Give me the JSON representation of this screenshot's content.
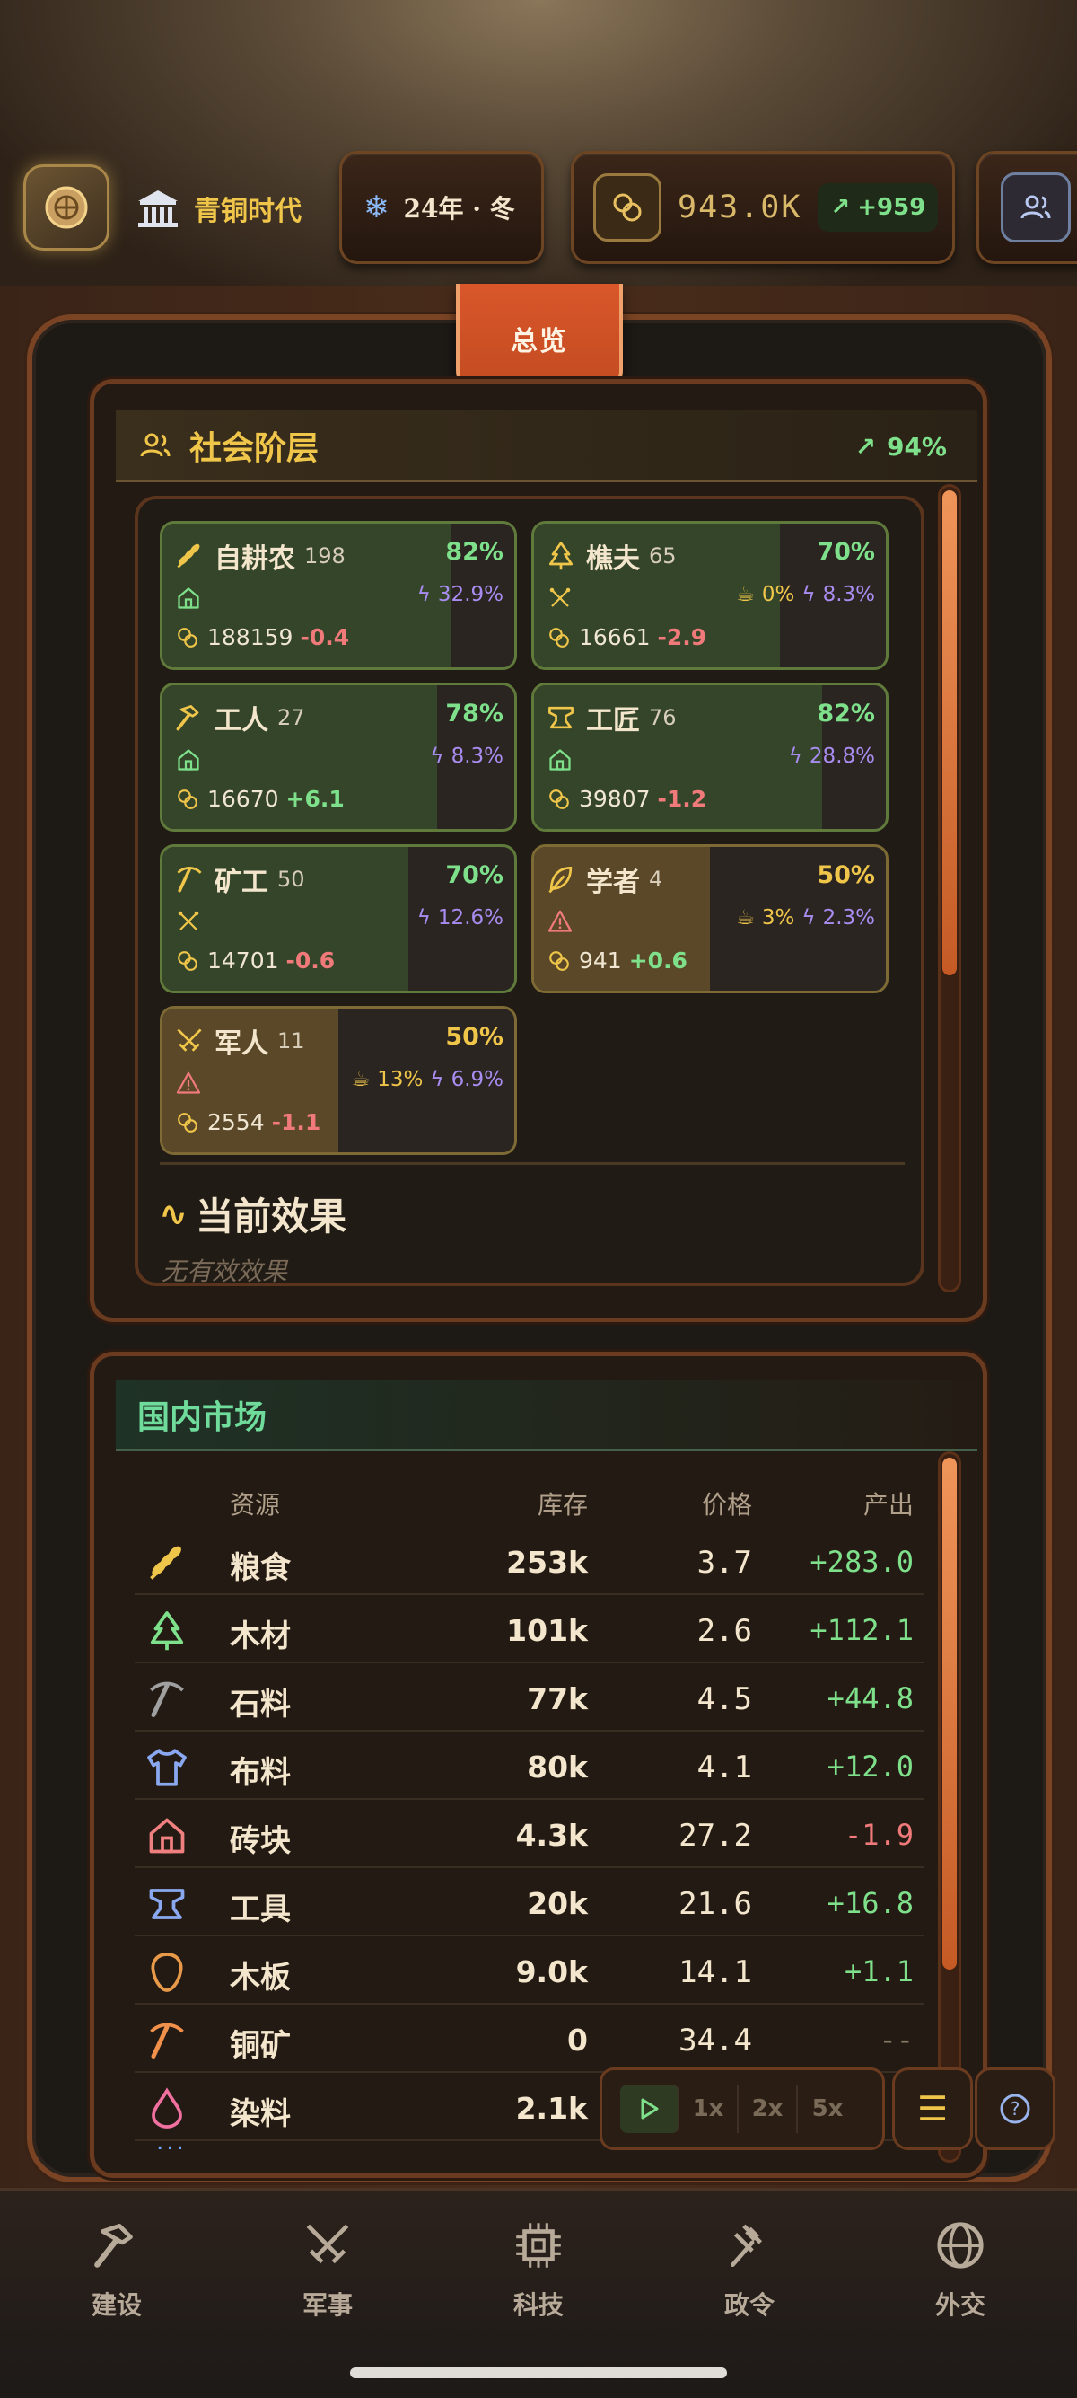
{
  "header": {
    "era": "青铜时代",
    "season": "24年 · 冬",
    "coins": "943.0K",
    "coin_delta": "+959"
  },
  "tab_overview": "总览",
  "social": {
    "title": "社会阶层",
    "approval": "94%",
    "cards": [
      {
        "name": "自耕农",
        "count": "198",
        "pct": "82%",
        "pct_color": "#7ee08a",
        "fill": 0.82,
        "tone": "green",
        "status_icon": "house-icon",
        "food": "",
        "energy": "32.9%",
        "money": "188159",
        "delta": "-0.4",
        "delta_sign": "neg",
        "icon": "wheat-icon"
      },
      {
        "name": "樵夫",
        "count": "65",
        "pct": "70%",
        "pct_color": "#7ee08a",
        "fill": 0.7,
        "tone": "green",
        "status_icon": "tools-icon",
        "food": "0%",
        "energy": "8.3%",
        "money": "16661",
        "delta": "-2.9",
        "delta_sign": "neg",
        "icon": "tree-icon"
      },
      {
        "name": "工人",
        "count": "27",
        "pct": "78%",
        "pct_color": "#7ee08a",
        "fill": 0.78,
        "tone": "green",
        "status_icon": "house-icon",
        "food": "",
        "energy": "8.3%",
        "money": "16670",
        "delta": "+6.1",
        "delta_sign": "pos",
        "icon": "hammer-icon"
      },
      {
        "name": "工匠",
        "count": "76",
        "pct": "82%",
        "pct_color": "#7ee08a",
        "fill": 0.82,
        "tone": "green",
        "status_icon": "house-icon",
        "food": "",
        "energy": "28.8%",
        "money": "39807",
        "delta": "-1.2",
        "delta_sign": "neg",
        "icon": "anvil-icon"
      },
      {
        "name": "矿工",
        "count": "50",
        "pct": "70%",
        "pct_color": "#7ee08a",
        "fill": 0.7,
        "tone": "green",
        "status_icon": "tools-icon",
        "food": "",
        "energy": "12.6%",
        "money": "14701",
        "delta": "-0.6",
        "delta_sign": "neg",
        "icon": "pickaxe-icon"
      },
      {
        "name": "学者",
        "count": "4",
        "pct": "50%",
        "pct_color": "#f0c64a",
        "fill": 0.5,
        "tone": "amber",
        "status_icon": "warning-icon",
        "food": "3%",
        "energy": "2.3%",
        "money": "941",
        "delta": "+0.6",
        "delta_sign": "pos",
        "icon": "feather-icon"
      },
      {
        "name": "军人",
        "count": "11",
        "pct": "50%",
        "pct_color": "#f0c64a",
        "fill": 0.5,
        "tone": "amber",
        "status_icon": "warning-icon",
        "food": "13%",
        "energy": "6.9%",
        "money": "2554",
        "delta": "-1.1",
        "delta_sign": "neg",
        "icon": "swords-icon"
      }
    ],
    "effects_title": "当前效果",
    "effects_empty": "无有效效果"
  },
  "market": {
    "title": "国内市场",
    "columns": {
      "resource": "资源",
      "stock": "库存",
      "price": "价格",
      "output": "产出"
    },
    "rows": [
      {
        "name": "粮食",
        "stock": "253k",
        "price": "3.7",
        "output": "+283.0",
        "sign": "pos",
        "icon": "wheat-icon",
        "color": "#f0c64a"
      },
      {
        "name": "木材",
        "stock": "101k",
        "price": "2.6",
        "output": "+112.1",
        "sign": "pos",
        "icon": "tree-icon",
        "color": "#7ee08a"
      },
      {
        "name": "石料",
        "stock": "77k",
        "price": "4.5",
        "output": "+44.8",
        "sign": "pos",
        "icon": "pickaxe-icon",
        "color": "#a0a0a0"
      },
      {
        "name": "布料",
        "stock": "80k",
        "price": "4.1",
        "output": "+12.0",
        "sign": "pos",
        "icon": "shirt-icon",
        "color": "#8aa8f0"
      },
      {
        "name": "砖块",
        "stock": "4.3k",
        "price": "27.2",
        "output": "-1.9",
        "sign": "neg",
        "icon": "house-icon",
        "color": "#f08080"
      },
      {
        "name": "工具",
        "stock": "20k",
        "price": "21.6",
        "output": "+16.8",
        "sign": "pos",
        "icon": "anvil-icon",
        "color": "#8aa8f0"
      },
      {
        "name": "木板",
        "stock": "9.0k",
        "price": "14.1",
        "output": "+1.1",
        "sign": "pos",
        "icon": "plank-icon",
        "color": "#e89a4a"
      },
      {
        "name": "铜矿",
        "stock": "0",
        "price": "34.4",
        "output": "--",
        "sign": "none",
        "icon": "pickaxe-icon",
        "color": "#f0904a"
      },
      {
        "name": "染料",
        "stock": "2.1k",
        "price": "",
        "output": "",
        "sign": "pos",
        "icon": "drop-icon",
        "color": "#f070a0"
      }
    ],
    "more": "..."
  },
  "speed": {
    "s1": "1x",
    "s2": "2x",
    "s5": "5x"
  },
  "nav": [
    {
      "label": "建设",
      "icon": "hammer-icon"
    },
    {
      "label": "军事",
      "icon": "swords-icon"
    },
    {
      "label": "科技",
      "icon": "chip-icon"
    },
    {
      "label": "政令",
      "icon": "gavel-icon"
    },
    {
      "label": "外交",
      "icon": "globe-icon"
    }
  ]
}
